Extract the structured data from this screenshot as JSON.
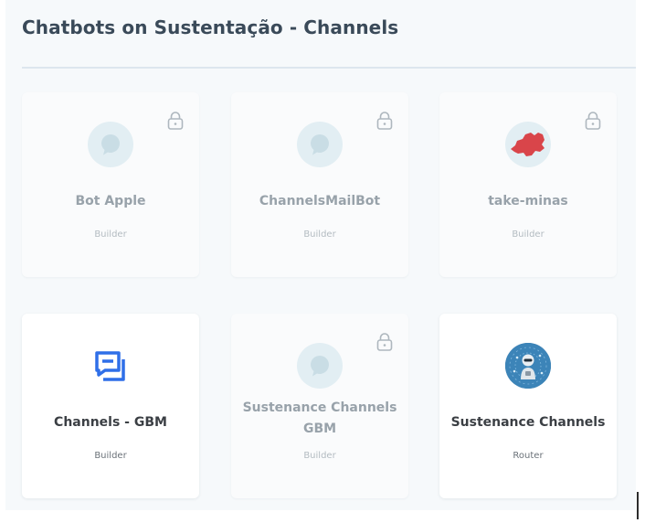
{
  "page": {
    "title": "Chatbots on Sustentação - Channels"
  },
  "colors": {
    "panel_bg": "#f6f9fb",
    "title": "#3a4a59",
    "disabled_text": "#98a2aa",
    "active_text": "#3b3f44",
    "gbm_blue": "#2f6fe8",
    "minas_red": "#d9454a"
  },
  "bots": [
    {
      "name": "Bot Apple",
      "type": "Builder",
      "locked": true,
      "icon": "chat-bubble-icon"
    },
    {
      "name": "ChannelsMailBot",
      "type": "Builder",
      "locked": true,
      "icon": "chat-bubble-icon"
    },
    {
      "name": "take-minas",
      "type": "Builder",
      "locked": true,
      "icon": "minas-map-icon"
    },
    {
      "name": "Channels - GBM",
      "type": "Builder",
      "locked": false,
      "icon": "gbm-messages-icon"
    },
    {
      "name": "Sustenance Channels GBM",
      "type": "Builder",
      "locked": true,
      "icon": "chat-bubble-icon"
    },
    {
      "name": "Sustenance Channels",
      "type": "Router",
      "locked": false,
      "icon": "robot-avatar-icon"
    }
  ]
}
